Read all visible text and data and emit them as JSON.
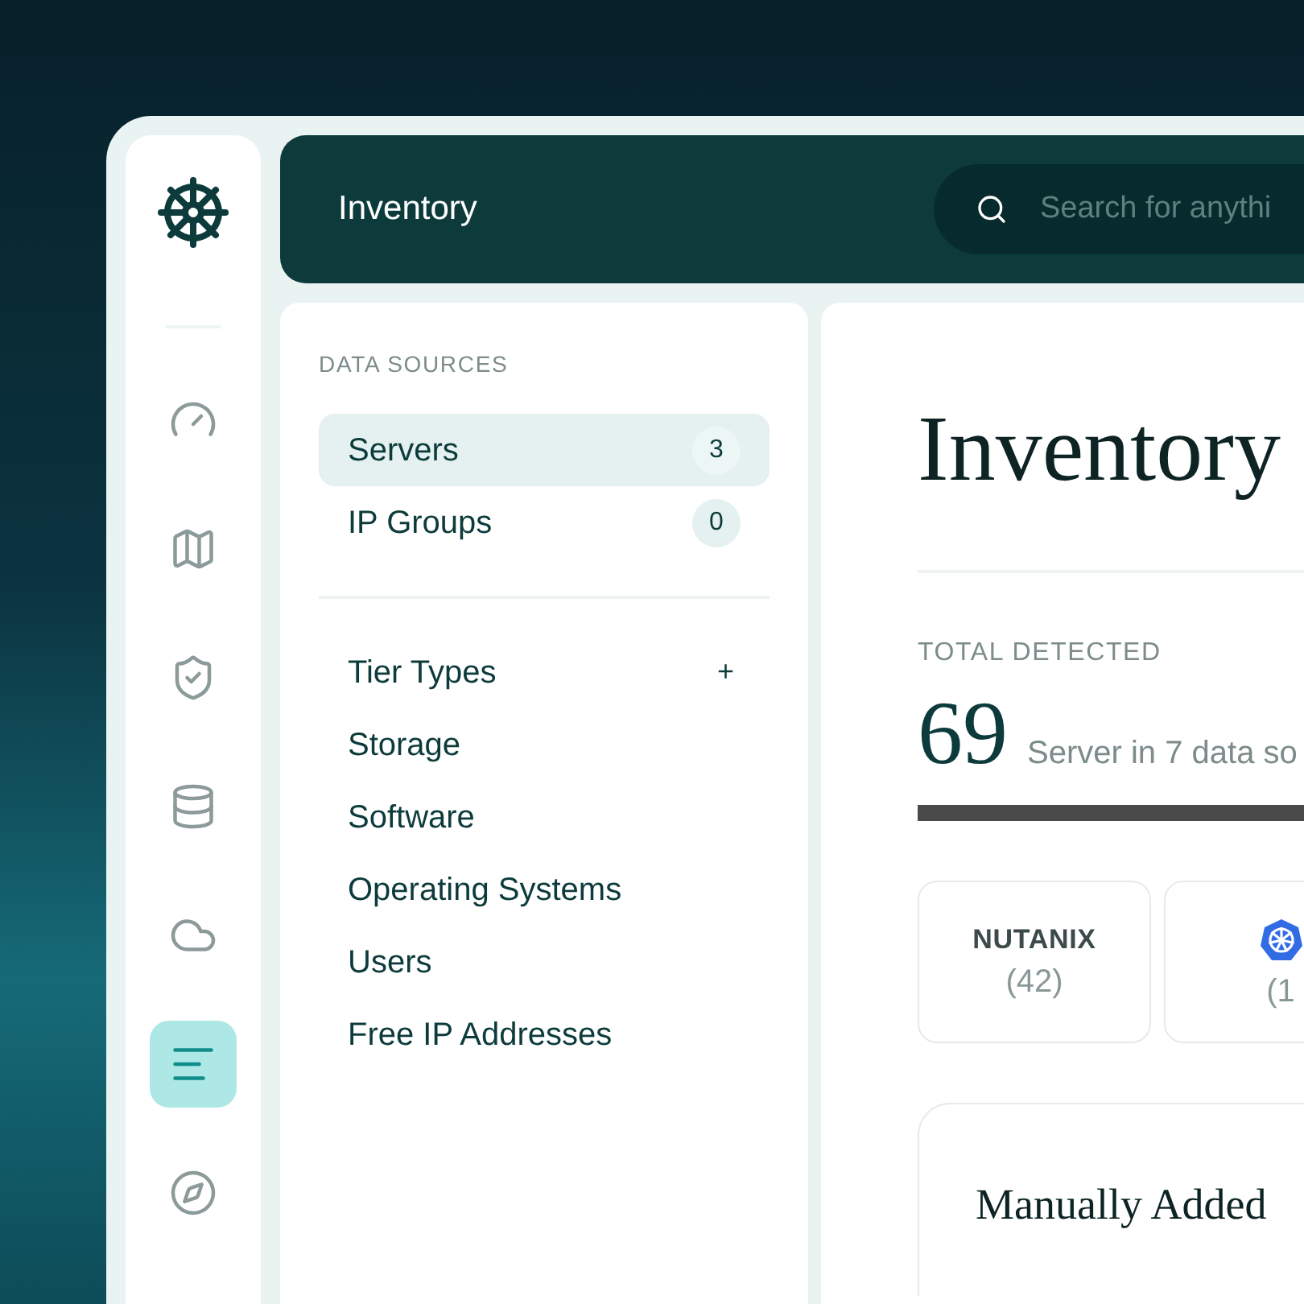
{
  "rail": {
    "items": [
      {
        "kind": "gauge",
        "selected": false
      },
      {
        "kind": "map",
        "selected": false
      },
      {
        "kind": "shield",
        "selected": false
      },
      {
        "kind": "database",
        "selected": false
      },
      {
        "kind": "cloud",
        "selected": false
      },
      {
        "kind": "list",
        "selected": true
      },
      {
        "kind": "compass",
        "selected": false
      }
    ]
  },
  "header": {
    "title": "Inventory",
    "search": {
      "placeholder": "Search for anythi"
    }
  },
  "data_sources": {
    "heading": "DATA SOURCES",
    "items": [
      {
        "label": "Servers",
        "count": "3",
        "selected": true
      },
      {
        "label": "IP Groups",
        "count": "0",
        "selected": false
      }
    ]
  },
  "categories": [
    {
      "label": "Tier Types",
      "action": "+"
    },
    {
      "label": "Storage"
    },
    {
      "label": "Software"
    },
    {
      "label": "Operating Systems"
    },
    {
      "label": "Users"
    },
    {
      "label": "Free IP Addresses"
    }
  ],
  "main": {
    "title": "Inventory",
    "total": {
      "label": "TOTAL DETECTED",
      "value": "69",
      "caption": "Server in 7 data so"
    },
    "sources": [
      {
        "kind": "wordmark",
        "name": "NUTANIX",
        "count": "(42)"
      },
      {
        "kind": "wheel-logo",
        "count": "(1"
      }
    ],
    "manual": {
      "title": "Manually Added"
    }
  }
}
